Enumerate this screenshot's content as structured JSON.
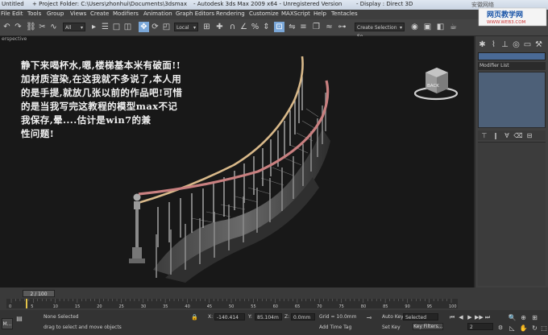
{
  "titlebar": {
    "title": "Untitled",
    "project_folder": "+ Project Folder: C:\\Users\\zhonhui\\Documents\\3dsmax",
    "app_name": "- Autodesk 3ds Max  2009 x64  - Unregistered Version",
    "display": "- Display : Direct 3D",
    "right_text": "安徽网络"
  },
  "menu": [
    "File",
    "Edit",
    "Tools",
    "Group",
    "Views",
    "Create",
    "Modifiers",
    "Animation",
    "Graph Editors",
    "Rendering",
    "Customize",
    "MAXScript",
    "Help",
    "Tentacles"
  ],
  "toolbar": {
    "selection_filter": "All",
    "reference_coord": "Local",
    "named_selection": "Create Selection Se"
  },
  "viewport": {
    "label": "erspective",
    "note": "静下来喝杯水,嗯,楼梯基本米有破面!!\n加材质渲染,在这我就不多说了,本人用\n的是手提,就放几张以前的作品吧!可惜\n的是当我写完这教程的模型max不记\n我保存,晕....估计是win7的兼\n性问题!",
    "viewcube_label": "BACK"
  },
  "command_panel": {
    "modifier_list": "Modifier List"
  },
  "timeline": {
    "frame_display": "2 / 100",
    "ticks": [
      "0",
      "5",
      "10",
      "15",
      "20",
      "25",
      "30",
      "35",
      "40",
      "45",
      "50",
      "55",
      "60",
      "65",
      "70",
      "75",
      "80",
      "85",
      "90",
      "95",
      "100"
    ]
  },
  "status": {
    "selection": "None Selected",
    "prompt": "drag to select and move objects",
    "x_label": "X:",
    "y_label": "Y:",
    "z_label": "Z:",
    "x_value": "-140.414",
    "y_value": "85.104m",
    "z_value": "0.0mm",
    "grid": "Grid = 10.0mm",
    "add_time_tag": "Add Time Tag",
    "auto_key": "Auto Key",
    "set_key": "Set Key",
    "selected": "Selected",
    "key_filters": "Key Filters...",
    "frame": "2",
    "taskbar": "M..."
  },
  "watermark": {
    "site_cn": "网页教学网",
    "site_url": "WWW.WEB3.COM"
  }
}
